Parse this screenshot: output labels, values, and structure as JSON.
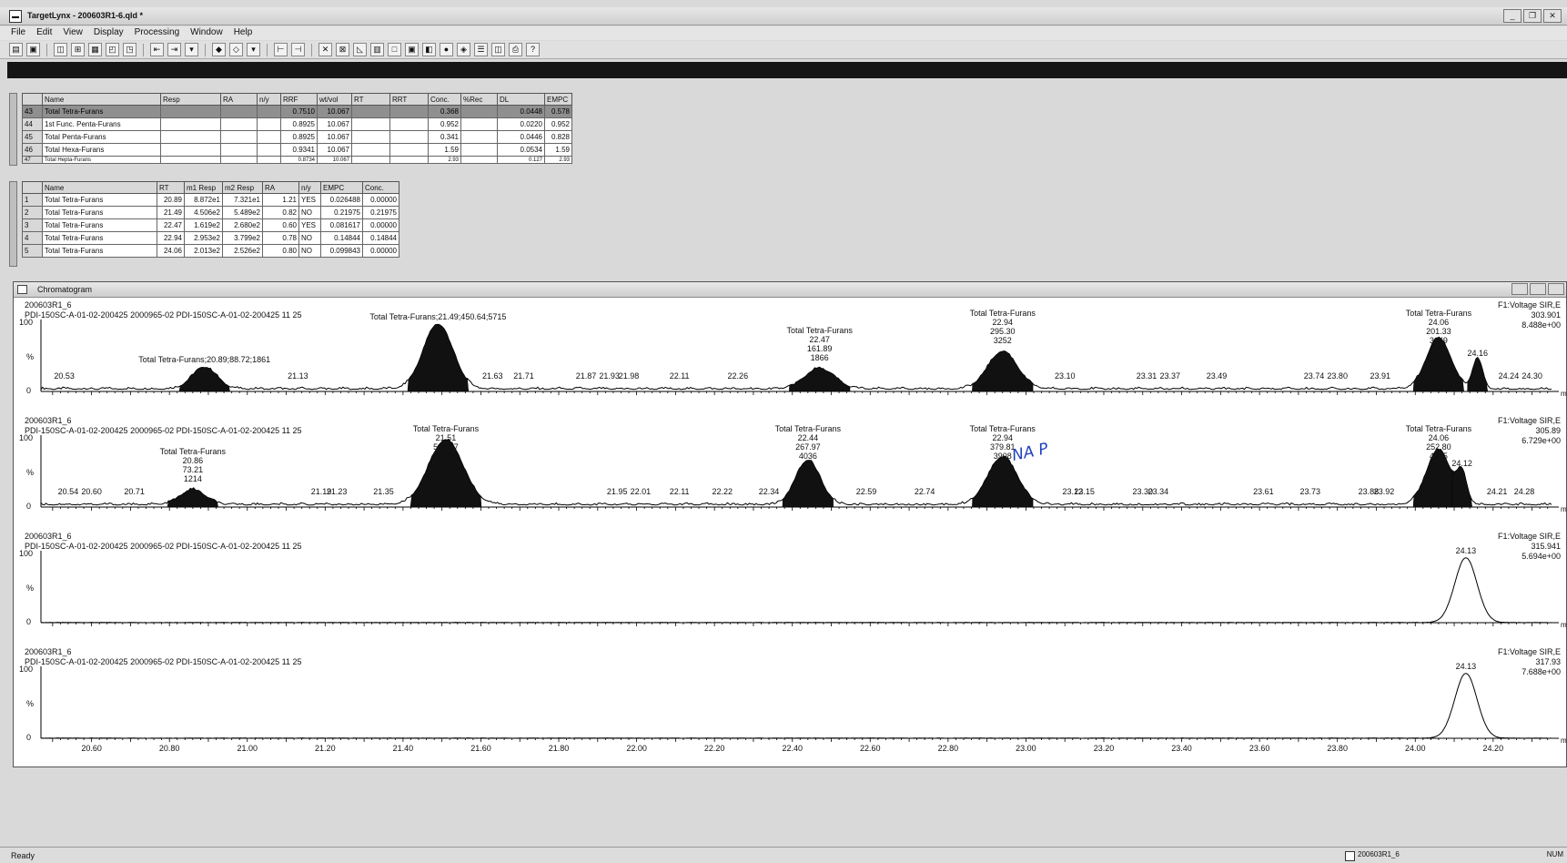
{
  "window": {
    "title": "TargetLynx - 200603R1-6.qld *",
    "controls": [
      "_",
      "❐",
      "✕"
    ]
  },
  "menu": [
    "File",
    "Edit",
    "View",
    "Display",
    "Processing",
    "Window",
    "Help"
  ],
  "toolbar": {
    "buttons_group1": [
      "open-icon",
      "save-icon",
      "print-preview-icon",
      "chart-icon",
      "grid-icon",
      "view-icon",
      "view2-icon"
    ],
    "buttons_group2": [
      "prev-icon",
      "next-icon",
      "dropdown-icon"
    ],
    "buttons_group3": [
      "back-icon",
      "forward-icon",
      "dropdown-icon"
    ],
    "buttons_group4": [
      "zoom-out-icon",
      "zoom-in-icon"
    ],
    "buttons_group5": [
      "close-x-icon",
      "layout1-icon",
      "layout2-icon",
      "layout3-icon",
      "layout4-icon",
      "layout5-icon",
      "layout6-icon",
      "record-icon",
      "color-icon",
      "list-icon",
      "split-icon",
      "printer-icon",
      "help-icon"
    ]
  },
  "summary_table": {
    "columns": [
      "",
      "Name",
      "Resp",
      "RA",
      "n/y",
      "RRF",
      "wt/vol",
      "RT",
      "RRT",
      "Conc.",
      "%Rec",
      "DL",
      "EMPC"
    ],
    "rows": [
      {
        "idx": "43",
        "name": "Total Tetra-Furans",
        "resp": "",
        "ra": "",
        "ny": "",
        "rrf": "0.7510",
        "wtvol": "10.067",
        "rt": "",
        "rrt": "",
        "conc": "0.368",
        "rec": "",
        "dl": "0.0448",
        "empc": "0.578",
        "selected": true
      },
      {
        "idx": "44",
        "name": "1st Func. Penta-Furans",
        "resp": "",
        "ra": "",
        "ny": "",
        "rrf": "0.8925",
        "wtvol": "10.067",
        "rt": "",
        "rrt": "",
        "conc": "0.952",
        "rec": "",
        "dl": "0.0220",
        "empc": "0.952",
        "selected": false
      },
      {
        "idx": "45",
        "name": "Total Penta-Furans",
        "resp": "",
        "ra": "",
        "ny": "",
        "rrf": "0.8925",
        "wtvol": "10.067",
        "rt": "",
        "rrt": "",
        "conc": "0.341",
        "rec": "",
        "dl": "0.0446",
        "empc": "0.828",
        "selected": false
      },
      {
        "idx": "46",
        "name": "Total Hexa-Furans",
        "resp": "",
        "ra": "",
        "ny": "",
        "rrf": "0.9341",
        "wtvol": "10.067",
        "rt": "",
        "rrt": "",
        "conc": "1.59",
        "rec": "",
        "dl": "0.0534",
        "empc": "1.59",
        "selected": false
      },
      {
        "idx": "47",
        "name": "Total Hepta-Furans",
        "resp": "",
        "ra": "",
        "ny": "",
        "rrf": "0.8734",
        "wtvol": "10.067",
        "rt": "",
        "rrt": "",
        "conc": "2.93",
        "rec": "",
        "dl": "0.127",
        "empc": "2.93",
        "selected": false
      }
    ]
  },
  "peak_table": {
    "columns": [
      "",
      "Name",
      "RT",
      "m1 Resp",
      "m2 Resp",
      "RA",
      "n/y",
      "EMPC",
      "Conc."
    ],
    "rows": [
      {
        "idx": "1",
        "name": "Total Tetra-Furans",
        "rt": "20.89",
        "m1": "8.872e1",
        "m2": "7.321e1",
        "ra": "1.21",
        "ny": "YES",
        "empc": "0.026488",
        "conc": "0.00000"
      },
      {
        "idx": "2",
        "name": "Total Tetra-Furans",
        "rt": "21.49",
        "m1": "4.506e2",
        "m2": "5.489e2",
        "ra": "0.82",
        "ny": "NO",
        "empc": "0.21975",
        "conc": "0.21975"
      },
      {
        "idx": "3",
        "name": "Total Tetra-Furans",
        "rt": "22.47",
        "m1": "1.619e2",
        "m2": "2.680e2",
        "ra": "0.60",
        "ny": "YES",
        "empc": "0.081617",
        "conc": "0.00000"
      },
      {
        "idx": "4",
        "name": "Total Tetra-Furans",
        "rt": "22.94",
        "m1": "2.953e2",
        "m2": "3.799e2",
        "ra": "0.78",
        "ny": "NO",
        "empc": "0.14844",
        "conc": "0.14844"
      },
      {
        "idx": "5",
        "name": "Total Tetra-Furans",
        "rt": "24.06",
        "m1": "2.013e2",
        "m2": "2.526e2",
        "ra": "0.80",
        "ny": "NO",
        "empc": "0.099843",
        "conc": "0.00000"
      }
    ]
  },
  "chromatogram": {
    "title": "Chromatogram",
    "x_ticks": [
      "20.60",
      "20.80",
      "21.00",
      "21.20",
      "21.40",
      "21.60",
      "21.80",
      "22.00",
      "22.20",
      "22.40",
      "22.60",
      "22.80",
      "23.00",
      "23.20",
      "23.40",
      "23.60",
      "23.80",
      "24.00",
      "24.20"
    ],
    "x_range": [
      20.47,
      24.35
    ],
    "y_labels": [
      "100",
      "%",
      "0"
    ],
    "x_unit": "min",
    "traces": [
      {
        "sample": "200603R1_6",
        "desc": "PDI-150SC-A-01-02-200425 2000965-02 PDI-150SC-A-01-02-200425 11 25",
        "function": "F1:Voltage SIR,E",
        "mass": "303.901",
        "intensity": "8.488e+00",
        "peaks": [
          {
            "rt": 20.89,
            "height": 0.32,
            "width": 0.05
          },
          {
            "rt": 21.49,
            "height": 0.95,
            "width": 0.06
          },
          {
            "rt": 22.47,
            "height": 0.3,
            "width": 0.06
          },
          {
            "rt": 22.94,
            "height": 0.55,
            "width": 0.06
          },
          {
            "rt": 24.06,
            "height": 0.75,
            "width": 0.05
          },
          {
            "rt": 24.16,
            "height": 0.45,
            "width": 0.02
          }
        ],
        "labels_big": [
          {
            "rt": 21.49,
            "text": "Total Tetra-Furans;21.49;450.64;5715"
          },
          {
            "rt": 22.47,
            "lines": [
              "Total Tetra-Furans",
              "22.47",
              "161.89",
              "1866"
            ]
          },
          {
            "rt": 22.94,
            "lines": [
              "Total Tetra-Furans",
              "22.94",
              "295.30",
              "3252"
            ]
          },
          {
            "rt": 24.06,
            "lines": [
              "Total Tetra-Furans",
              "24.06",
              "201.33",
              "3449"
            ]
          },
          {
            "rt": 20.89,
            "text": "Total Tetra-Furans;20.89;88.72;1861"
          }
        ],
        "labels_small": [
          "20.53",
          "21.13",
          "21.63",
          "21.71",
          "21.87",
          "21.93",
          "21.98",
          "22.11",
          "22.26",
          "23.10",
          "23.31",
          "23.37",
          "23.49",
          "23.74",
          "23.80",
          "23.91",
          "24.16",
          "24.24",
          "24.30"
        ]
      },
      {
        "sample": "200603R1_6",
        "desc": "PDI-150SC-A-01-02-200425 2000965-02 PDI-150SC-A-01-02-200425 11 25",
        "function": "F1:Voltage SIR,E",
        "mass": "305.89",
        "intensity": "6.729e+00",
        "peaks": [
          {
            "rt": 20.86,
            "height": 0.22,
            "width": 0.05
          },
          {
            "rt": 21.51,
            "height": 0.95,
            "width": 0.07
          },
          {
            "rt": 22.44,
            "height": 0.65,
            "width": 0.05
          },
          {
            "rt": 22.94,
            "height": 0.7,
            "width": 0.06
          },
          {
            "rt": 24.06,
            "height": 0.8,
            "width": 0.05
          },
          {
            "rt": 24.12,
            "height": 0.4,
            "width": 0.02
          }
        ],
        "labels_big": [
          {
            "rt": 20.86,
            "lines": [
              "Total Tetra-Furans",
              "20.86",
              "73.21",
              "1214"
            ]
          },
          {
            "rt": 21.51,
            "lines": [
              "Total Tetra-Furans",
              "21.51",
              "548.87",
              "5737"
            ]
          },
          {
            "rt": 22.44,
            "lines": [
              "Total Tetra-Furans",
              "22.44",
              "267.97",
              "4036"
            ]
          },
          {
            "rt": 22.94,
            "lines": [
              "Total Tetra-Furans",
              "22.94",
              "379.81",
              "3908"
            ]
          },
          {
            "rt": 24.06,
            "lines": [
              "Total Tetra-Furans",
              "24.06",
              "252.80",
              "4015"
            ]
          }
        ],
        "labels_small": [
          "20.54",
          "20.60",
          "20.71",
          "21.19",
          "21.23",
          "21.35",
          "21.95",
          "22.01",
          "22.11",
          "22.22",
          "22.34",
          "22.59",
          "22.74",
          "23.12",
          "23.15",
          "23.30",
          "23.34",
          "23.61",
          "23.73",
          "23.88",
          "23.92",
          "24.12",
          "24.21",
          "24.28"
        ],
        "annotation": "NA P"
      },
      {
        "sample": "200603R1_6",
        "desc": "PDI-150SC-A-01-02-200425 2000965-02 PDI-150SC-A-01-02-200425 11 25",
        "function": "F1:Voltage SIR,E",
        "mass": "315.941",
        "intensity": "5.694e+00",
        "peaks": [
          {
            "rt": 24.13,
            "height": 0.95,
            "width": 0.045
          }
        ],
        "labels_small": [
          "24.13"
        ]
      },
      {
        "sample": "200603R1_6",
        "desc": "PDI-150SC-A-01-02-200425 2000965-02 PDI-150SC-A-01-02-200425 11 25",
        "function": "F1:Voltage SIR,E",
        "mass": "317.93",
        "intensity": "7.688e+00",
        "peaks": [
          {
            "rt": 24.13,
            "height": 0.95,
            "width": 0.045
          }
        ],
        "labels_small": [
          "24.13"
        ]
      }
    ]
  },
  "status": {
    "ready": "Ready",
    "file": "200603R1_6",
    "num": "NUM"
  }
}
